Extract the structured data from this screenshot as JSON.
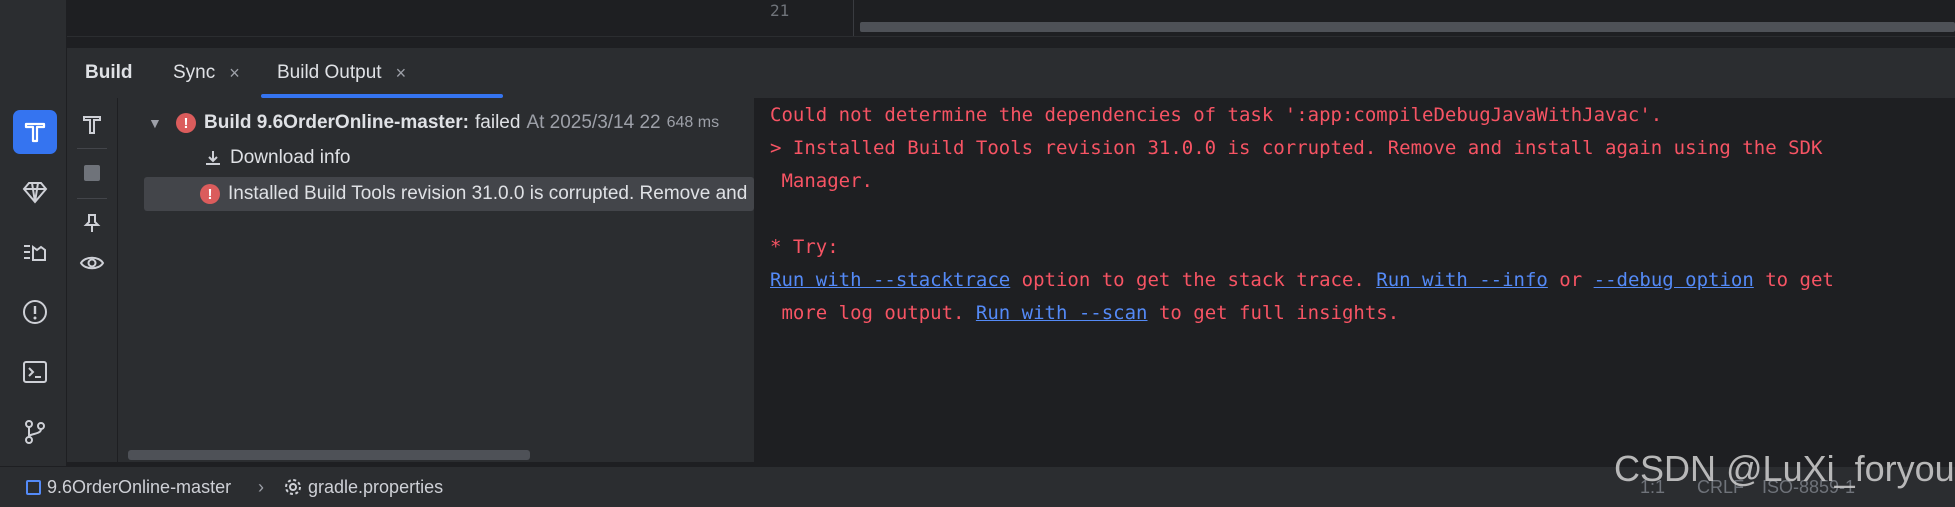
{
  "editor": {
    "line_number": "21"
  },
  "tabs": {
    "panel_title": "Build",
    "items": [
      {
        "label": "Sync",
        "close": "×"
      },
      {
        "label": "Build Output",
        "close": "×"
      }
    ],
    "more": "⋮"
  },
  "tree": {
    "root": {
      "name": "Build 9.6OrderOnline-master:",
      "status": "failed",
      "time": "At 2025/3/14 22",
      "duration": "648 ms"
    },
    "download": "Download info",
    "error": "Installed Build Tools revision 31.0.0 is corrupted. Remove and"
  },
  "console": {
    "line1": "Could not determine the dependencies of task ':app:compileDebugJavaWithJavac'.",
    "line2": "> Installed Build Tools revision 31.0.0 is corrupted. Remove and install again using the SDK",
    "line3": " Manager.",
    "line4": "* Try:",
    "link_stacktrace": "Run with --stacktrace",
    "text_stacktrace": " option to get the stack trace. ",
    "link_info": "Run with --info",
    "text_or": " or ",
    "link_debug": "--debug option",
    "text_toget": " to get",
    "text_more": " more log output. ",
    "link_scan": "Run with --scan",
    "text_insights": " to get full insights."
  },
  "status_bar": {
    "project": "9.6OrderOnline-master",
    "file": "gradle.properties",
    "position": "1:1",
    "line_sep": "CRLF",
    "encoding": "ISO-8859-1"
  },
  "watermark": "CSDN @LuXi_foryou",
  "colors": {
    "accent": "#3574f0",
    "error": "#f75464",
    "link": "#548af7"
  }
}
